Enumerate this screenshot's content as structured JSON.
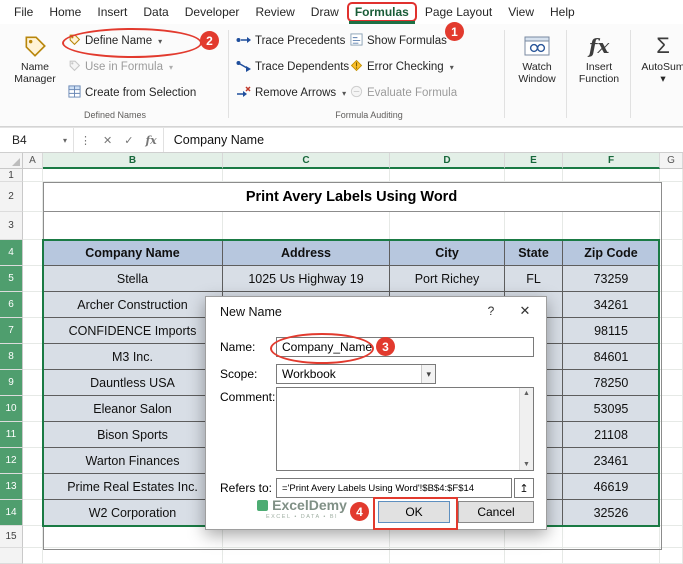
{
  "tabs": [
    "File",
    "Home",
    "Insert",
    "Data",
    "Developer",
    "Review",
    "Draw",
    "Formulas",
    "Page Layout",
    "View",
    "Help"
  ],
  "ribbon": {
    "defined_names": {
      "label": "Defined Names",
      "name_manager_lines": [
        "Name",
        "Manager"
      ],
      "define_name": "Define Name",
      "use_in_formula": "Use in Formula",
      "create_from_selection": "Create from Selection"
    },
    "formula_auditing": {
      "label": "Formula Auditing",
      "trace_precedents": "Trace Precedents",
      "trace_dependents": "Trace Dependents",
      "remove_arrows": "Remove Arrows",
      "show_formulas": "Show Formulas",
      "error_checking": "Error Checking",
      "evaluate_formula": "Evaluate Formula"
    },
    "watch_window_lines": [
      "Watch",
      "Window"
    ],
    "insert_function_lines": [
      "Insert",
      "Function"
    ],
    "autosum": "AutoSum"
  },
  "annotations": {
    "step1": "1",
    "step2": "2",
    "step3": "3",
    "step4": "4"
  },
  "formula_bar": {
    "name_box": "B4",
    "content": "Company Name"
  },
  "icons": {
    "fx": "fx",
    "sigma": "Σ",
    "check": "✓",
    "close": "✕",
    "chevron": "▾",
    "dots": "⋮",
    "collapse": "↥",
    "help": "?",
    "scroll_up": "▲",
    "scroll_down": "▼"
  },
  "grid": {
    "column_letters": [
      "A",
      "B",
      "C",
      "D",
      "E",
      "F",
      "G"
    ],
    "row_numbers": [
      "1",
      "2",
      "3",
      "4",
      "5",
      "6",
      "7",
      "8",
      "9",
      "10",
      "11",
      "12",
      "13",
      "14",
      "15"
    ],
    "title": "Print Avery Labels Using Word",
    "table": {
      "headers": [
        "Company Name",
        "Address",
        "City",
        "State",
        "Zip Code"
      ],
      "rows": [
        [
          "Stella",
          "1025 Us Highway 19",
          "Port Richey",
          "FL",
          "73259"
        ],
        [
          "Archer Construction",
          "",
          "",
          "",
          "34261"
        ],
        [
          "CONFIDENCE Imports",
          "",
          "",
          "",
          "98115"
        ],
        [
          "M3 Inc.",
          "",
          "",
          "",
          "84601"
        ],
        [
          "Dauntless USA",
          "",
          "",
          "",
          "78250"
        ],
        [
          "Eleanor Salon",
          "",
          "",
          "",
          "53095"
        ],
        [
          "Bison Sports",
          "",
          "",
          "",
          "21108"
        ],
        [
          "Warton Finances",
          "",
          "",
          "",
          "23461"
        ],
        [
          "Prime Real Estates Inc.",
          "",
          "",
          "",
          "46619"
        ],
        [
          "W2 Corporation",
          "",
          "",
          "",
          "32526"
        ]
      ]
    }
  },
  "dialog": {
    "title": "New Name",
    "name_label": "Name:",
    "name_value": "Company_Name",
    "scope_label": "Scope:",
    "scope_value": "Workbook",
    "comment_label": "Comment:",
    "refers_to_label": "Refers to:",
    "refers_to_value": "='Print Avery Labels Using Word'!$B$4:$F$14",
    "ok_label": "OK",
    "cancel_label": "Cancel"
  },
  "watermark": {
    "brand": "ExcelDemy",
    "tagline": "EXCEL • DATA • BI"
  }
}
